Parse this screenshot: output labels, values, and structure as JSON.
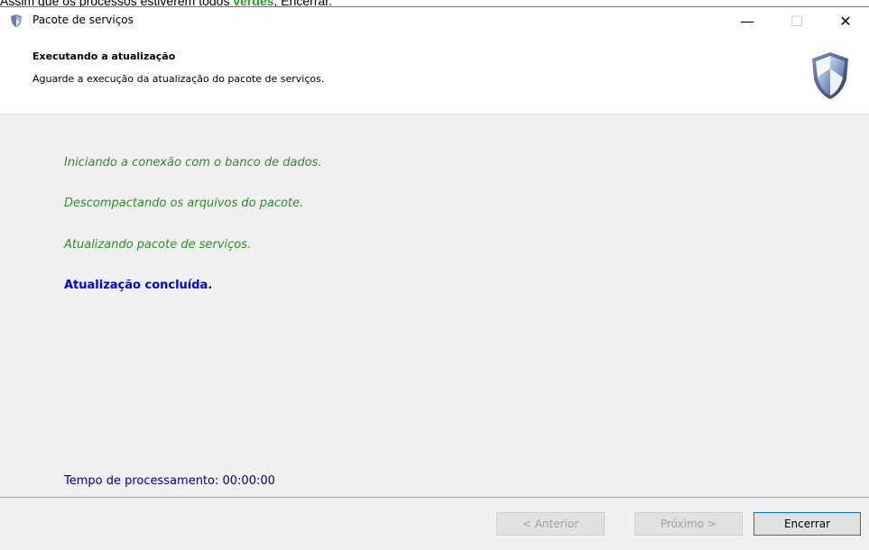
{
  "caption": {
    "before": "Assim que os processos estiverem todos ",
    "highlight": "verdes",
    "after": ", Encerrar."
  },
  "window": {
    "title": "Pacote de serviços",
    "icon": "shield-icon",
    "controls": {
      "minimize": "—",
      "maximize": "☐",
      "close": "✕"
    }
  },
  "header": {
    "title": "Executando a atualização",
    "subtitle": "Aguarde a execução da atualização do pacote de serviços.",
    "icon": "shield-icon"
  },
  "content": {
    "steps": [
      "Iniciando a conexão com o banco de dados.",
      "Descompactando os arquivos do pacote.",
      "Atualizando pacote de serviços."
    ],
    "completed": "Atualização concluída.",
    "elapsed": "Tempo de processamento: 00:00:00",
    "colors": {
      "step": "#2e8b2e",
      "completed": "#0000e6",
      "elapsed": "#00008b"
    }
  },
  "footer": {
    "prev_label": "< Anterior",
    "next_label": "Próximo >",
    "finish_label": "Encerrar"
  }
}
